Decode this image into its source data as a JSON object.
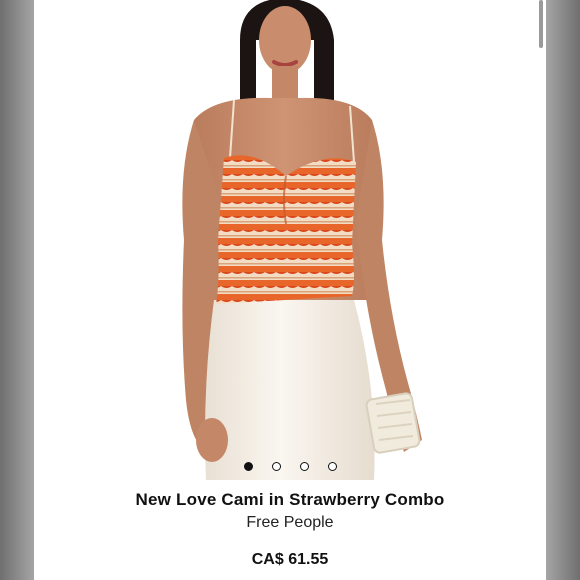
{
  "product": {
    "title": "New Love Cami in Strawberry Combo",
    "brand": "Free People",
    "price": "CA$ 61.55"
  },
  "carousel": {
    "slides": 4,
    "active_index": 0
  },
  "colors": {
    "accent_text": "#111111",
    "background": "#ffffff",
    "top_orange": "#e8662a",
    "top_cream": "#f3dcc4",
    "skirt": "#f3ece2"
  },
  "icons": [
    "carousel-dot-icon"
  ]
}
